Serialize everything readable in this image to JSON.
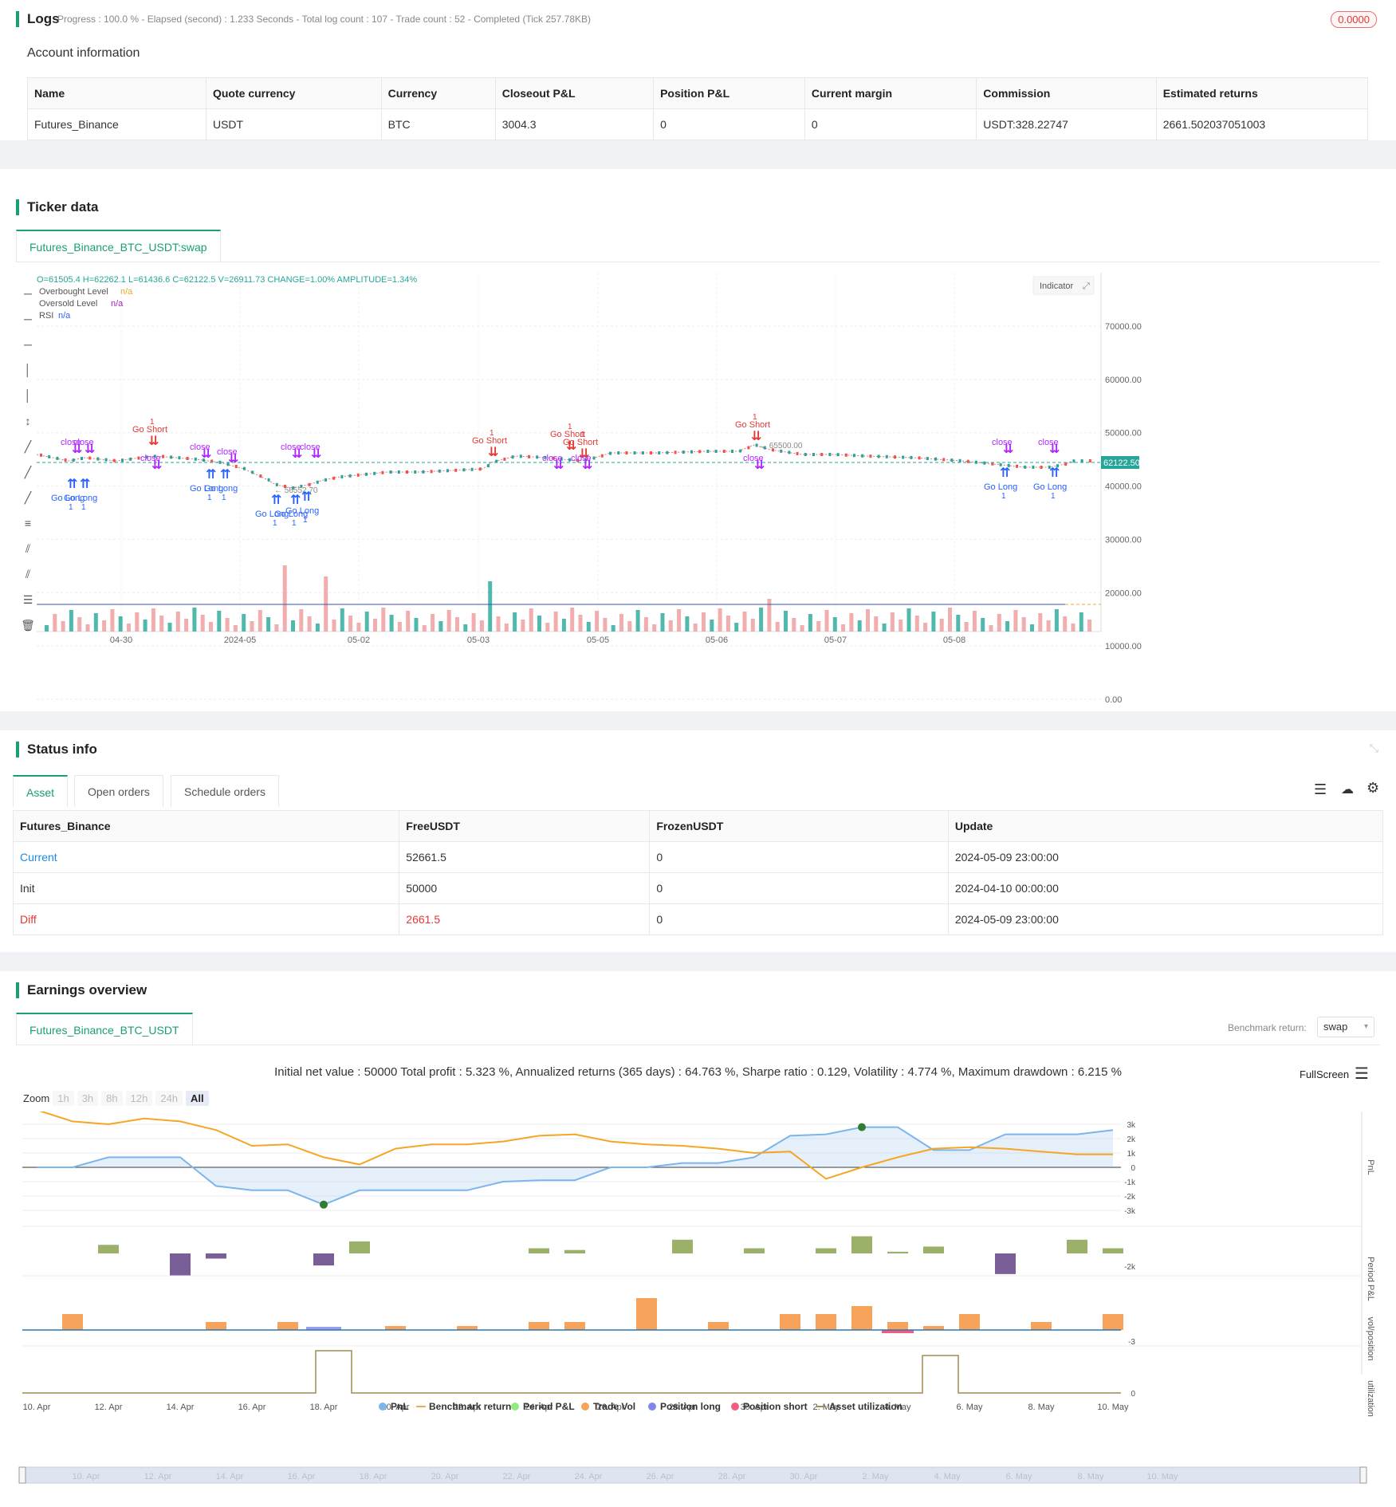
{
  "logs": {
    "title": "Logs",
    "progress": "Progress : 100.0 % - Elapsed (second) : 1.233  Seconds - Total log count : 107 - Trade count : 52 - Completed (Tick 257.78KB)",
    "badge": "0.0000"
  },
  "account": {
    "title": "Account information",
    "headers": [
      "Name",
      "Quote currency",
      "Currency",
      "Closeout P&L",
      "Position P&L",
      "Current margin",
      "Commission",
      "Estimated returns"
    ],
    "row": [
      "Futures_Binance",
      "USDT",
      "BTC",
      "3004.3",
      "0",
      "0",
      "USDT:328.22747",
      "2661.502037051003"
    ]
  },
  "ticker": {
    "title": "Ticker data",
    "tab": "Futures_Binance_BTC_USDT:swap",
    "ohlc": "O=61505.4 H=62262.1 L=61436.6 C=62122.5 V=26911.73 CHANGE=1.00% AMPLITUDE=1.34%",
    "legend": [
      {
        "label": "Overbought Level",
        "value": "n/a",
        "color": "#f5a623"
      },
      {
        "label": "Oversold Level",
        "value": "n/a",
        "color": "#9c27b0"
      },
      {
        "label": "RSI",
        "value": "n/a",
        "color": "#2962ff"
      }
    ],
    "indicator_btn": "Indicator",
    "price_tag": "62122.50",
    "y_ticks": [
      "70000.00",
      "60000.00",
      "50000.00",
      "40000.00",
      "30000.00",
      "20000.00",
      "10000.00",
      "0.00"
    ],
    "x_ticks": [
      "04-30",
      "2024-05",
      "05-02",
      "05-03",
      "05-05",
      "05-06",
      "05-07",
      "05-08"
    ],
    "low_label": "56552.70",
    "high_label": "65500.00",
    "signals": {
      "go_long": "Go Long",
      "go_short": "Go Short",
      "close": "close",
      "one": "1"
    }
  },
  "status": {
    "title": "Status info",
    "tabs": [
      "Asset",
      "Open orders",
      "Schedule orders"
    ],
    "headers": [
      "Futures_Binance",
      "FreeUSDT",
      "FrozenUSDT",
      "Update"
    ],
    "rows": [
      {
        "name": "Current",
        "free": "52661.5",
        "frozen": "0",
        "update": "2024-05-09 23:00:00"
      },
      {
        "name": "Init",
        "free": "50000",
        "frozen": "0",
        "update": "2024-04-10 00:00:00"
      },
      {
        "name": "Diff",
        "free": "2661.5",
        "frozen": "0",
        "update": "2024-05-09 23:00:00"
      }
    ]
  },
  "earnings": {
    "title": "Earnings overview",
    "tab": "Futures_Binance_BTC_USDT",
    "benchmark_label": "Benchmark return:",
    "benchmark_value": "swap",
    "summary": "Initial net value : 50000 Total profit : 5.323 %, Annualized returns (365 days) : 64.763 %, Sharpe ratio : 0.129, Volatility : 4.774 %, Maximum drawdown : 6.215 %",
    "fullscreen": "FullScreen",
    "zoom_label": "Zoom",
    "zoom_opts": [
      "1h",
      "3h",
      "8h",
      "12h",
      "24h",
      "All"
    ],
    "pnl_ticks": [
      "3k",
      "2k",
      "1k",
      "0",
      "-1k",
      "-2k",
      "-3k"
    ],
    "period_ticks": [
      "-2k"
    ],
    "vol_ticks": [
      "-3"
    ],
    "util_ticks": [
      "0"
    ],
    "axis_labels": [
      "PnL",
      "Period P&L",
      "vol/position",
      "utilization"
    ],
    "x_ticks": [
      "10. Apr",
      "12. Apr",
      "14. Apr",
      "16. Apr",
      "18. Apr",
      "20. Apr",
      "22. Apr",
      "24. Apr",
      "26. Apr",
      "28. Apr",
      "30. Apr",
      "2. May",
      "4. May",
      "6. May",
      "8. May",
      "10. May"
    ],
    "legend": [
      {
        "label": "PnL",
        "color": "#7cb5ec"
      },
      {
        "label": "Benchmark return",
        "color": "#f7a35c"
      },
      {
        "label": "Period P&L",
        "color": "#90ed7d"
      },
      {
        "label": "Trade Vol",
        "color": "#f7a35c"
      },
      {
        "label": "Position long",
        "color": "#8085e9"
      },
      {
        "label": "Position short",
        "color": "#f15c80"
      },
      {
        "label": "Asset utilization",
        "color": "#a08c50"
      }
    ]
  },
  "chart_data": {
    "type": "line",
    "x": [
      "10. Apr",
      "11. Apr",
      "12. Apr",
      "13. Apr",
      "14. Apr",
      "15. Apr",
      "16. Apr",
      "17. Apr",
      "18. Apr",
      "19. Apr",
      "20. Apr",
      "21. Apr",
      "22. Apr",
      "23. Apr",
      "24. Apr",
      "25. Apr",
      "26. Apr",
      "27. Apr",
      "28. Apr",
      "29. Apr",
      "30. Apr",
      "1. May",
      "2. May",
      "3. May",
      "4. May",
      "5. May",
      "6. May",
      "7. May",
      "8. May",
      "9. May",
      "10. May"
    ],
    "series": [
      {
        "name": "PnL",
        "values": [
          0,
          0,
          700,
          700,
          700,
          -1300,
          -1600,
          -1600,
          -2600,
          -1600,
          -1600,
          -1600,
          -1600,
          -1000,
          -900,
          -900,
          0,
          0,
          300,
          300,
          700,
          2200,
          2300,
          2800,
          2800,
          1200,
          1200,
          2300,
          2300,
          2300,
          2600
        ]
      },
      {
        "name": "Benchmark return",
        "values": [
          4000,
          3200,
          3000,
          3400,
          3200,
          2600,
          1500,
          1600,
          700,
          200,
          1300,
          1600,
          1600,
          1800,
          2200,
          2300,
          1800,
          1600,
          1500,
          1300,
          1000,
          1100,
          -800,
          0,
          700,
          1300,
          1400,
          1300,
          1100,
          900,
          900
        ]
      }
    ],
    "ylim": [
      -3000,
      3000
    ]
  }
}
